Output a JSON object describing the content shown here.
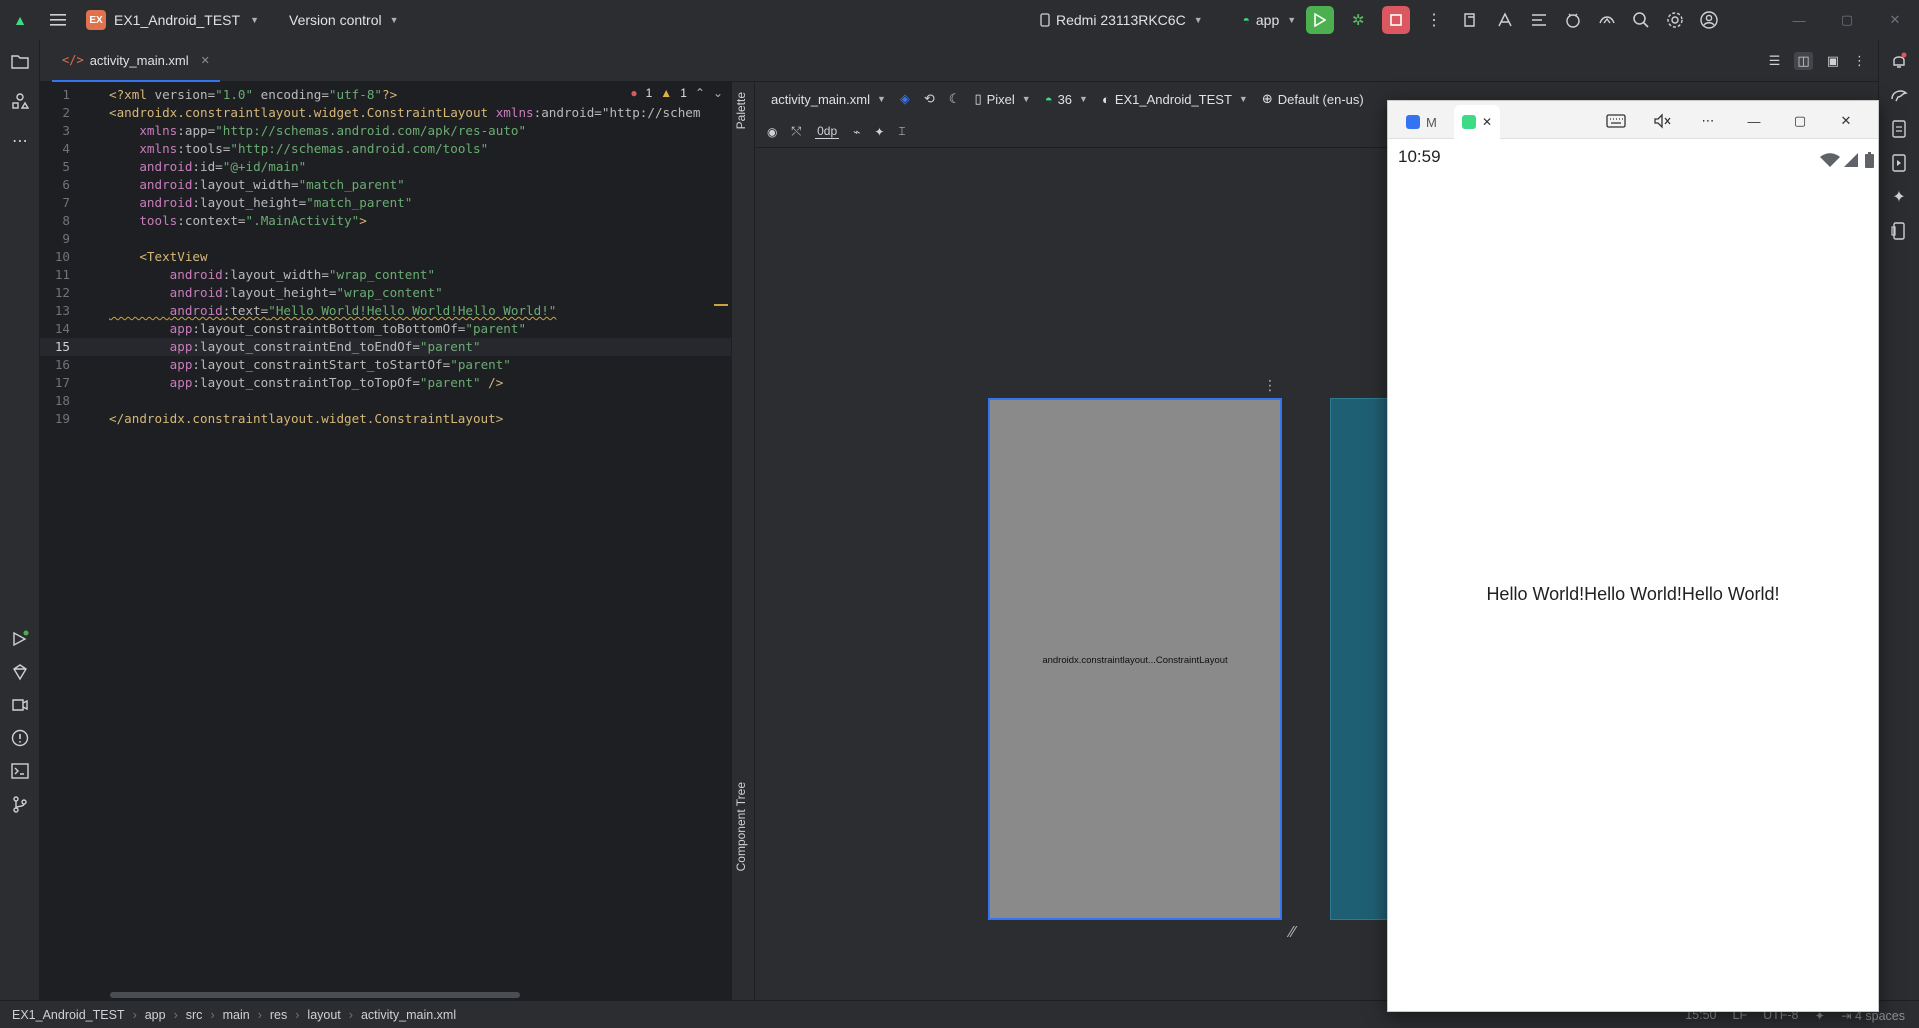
{
  "titlebar": {
    "project_badge": "EX",
    "project_name": "EX1_Android_TEST",
    "version_control": "Version control",
    "device": "Redmi 23113RKC6C",
    "run_config": "app"
  },
  "tab": {
    "label": "activity_main.xml"
  },
  "inspection": {
    "errors": "1",
    "warnings": "1"
  },
  "editor": {
    "line_numbers": [
      "1",
      "2",
      "3",
      "4",
      "5",
      "6",
      "7",
      "8",
      "9",
      "10",
      "11",
      "12",
      "13",
      "14",
      "15",
      "16",
      "17",
      "18",
      "19"
    ],
    "current_line": 15,
    "lines": [
      "<?xml version=\"1.0\" encoding=\"utf-8\"?>",
      "<androidx.constraintlayout.widget.ConstraintLayout xmlns:android=\"http://schem",
      "    xmlns:app=\"http://schemas.android.com/apk/res-auto\"",
      "    xmlns:tools=\"http://schemas.android.com/tools\"",
      "    android:id=\"@+id/main\"",
      "    android:layout_width=\"match_parent\"",
      "    android:layout_height=\"match_parent\"",
      "    tools:context=\".MainActivity\">",
      "",
      "    <TextView",
      "        android:layout_width=\"wrap_content\"",
      "        android:layout_height=\"wrap_content\"",
      "        android:text=\"Hello World!Hello World!Hello World!\"",
      "        app:layout_constraintBottom_toBottomOf=\"parent\"",
      "        app:layout_constraintEnd_toEndOf=\"parent\"",
      "        app:layout_constraintStart_toStartOf=\"parent\"",
      "        app:layout_constraintTop_toTopOf=\"parent\" />",
      "",
      "</androidx.constraintlayout.widget.ConstraintLayout>"
    ]
  },
  "side_panels": {
    "palette": "Palette",
    "component_tree": "Component Tree"
  },
  "design_toolbar": {
    "file": "activity_main.xml",
    "device": "Pixel",
    "api": "36",
    "theme": "EX1_Android_TEST",
    "locale": "Default (en-us)",
    "margin": "0dp"
  },
  "blueprint": {
    "label": "androidx.constraintlayout...ConstraintLayout"
  },
  "emulator": {
    "tab1_label": "M",
    "clock": "10:59",
    "hello_text": "Hello World!Hello World!Hello World!"
  },
  "breadcrumb": [
    "EX1_Android_TEST",
    "app",
    "src",
    "main",
    "res",
    "layout",
    "activity_main.xml"
  ],
  "status": {
    "position": "15:50",
    "line_sep": "LF",
    "encoding": "UTF-8",
    "indent": "4 spaces"
  },
  "colors": {
    "accent": "#3574f0",
    "run_green": "#4cb050",
    "stop_red": "#db5860",
    "android_green": "#3ddc84"
  }
}
